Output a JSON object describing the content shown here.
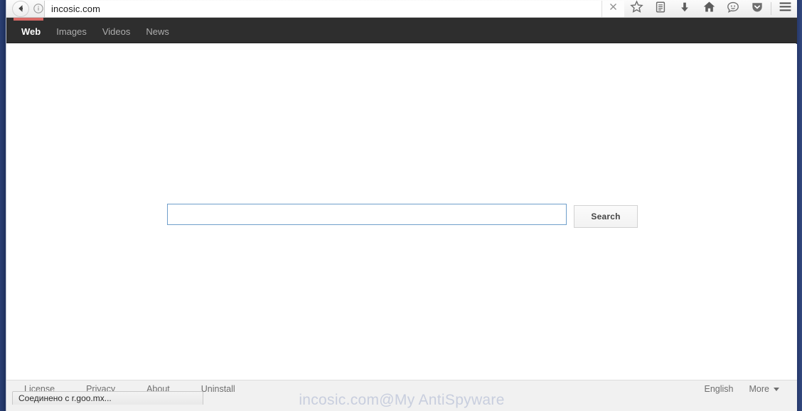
{
  "browser": {
    "back_icon": "back-arrow-icon",
    "identity_icon": "info-circle-icon",
    "url": "incosic.com",
    "stop_icon": "close-icon",
    "toolbar_icons": [
      {
        "name": "bookmark-star-icon",
        "label": "Bookmark"
      },
      {
        "name": "reader-library-icon",
        "label": "Library"
      },
      {
        "name": "download-arrow-icon",
        "label": "Downloads"
      },
      {
        "name": "home-icon",
        "label": "Home"
      },
      {
        "name": "chat-smiley-icon",
        "label": "Feedback"
      },
      {
        "name": "pocket-shield-icon",
        "label": "Pocket"
      },
      {
        "name": "hamburger-menu-icon",
        "label": "Menu"
      }
    ],
    "status_text": "Соединено с r.goo.mx..."
  },
  "site_nav": {
    "accent_color": "#d96a66",
    "tabs": [
      {
        "label": "Web",
        "active": true
      },
      {
        "label": "Images",
        "active": false
      },
      {
        "label": "Videos",
        "active": false
      },
      {
        "label": "News",
        "active": false
      }
    ]
  },
  "search": {
    "value": "",
    "placeholder": "",
    "button_label": "Search"
  },
  "footer": {
    "links": [
      "License",
      "Privacy",
      "About",
      "Uninstall"
    ],
    "language": "English",
    "more_label": "More"
  },
  "watermark": {
    "text": "incosic.com@My AntiSpyware"
  },
  "colors": {
    "nav_background": "#2e2e2e",
    "nav_accent": "#d96a66",
    "input_border": "#6f9fcb",
    "footer_background": "#f1f1f1",
    "desktop_background": "#1d2f5c"
  }
}
